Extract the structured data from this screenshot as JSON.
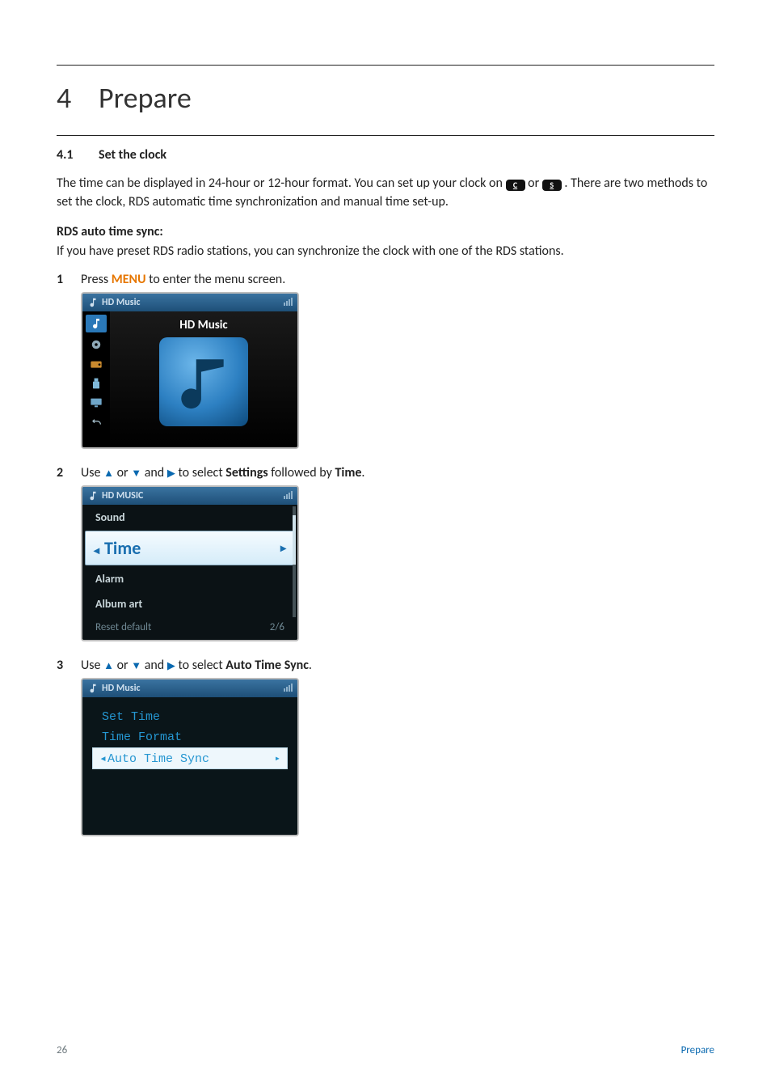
{
  "chapter": {
    "num": "4",
    "title": "Prepare"
  },
  "section": {
    "num": "4.1",
    "title": "Set the clock"
  },
  "intro_parts": {
    "a": "The time can be displayed in 24-hour or 12-hour format. You can set up your clock on ",
    "b": " or ",
    "c": ". There are two methods to set the clock, RDS automatic time synchronization and manual time set-up."
  },
  "badges": {
    "c": "C",
    "s": "S"
  },
  "rds": {
    "heading": "RDS auto time sync:",
    "text": "If you have preset RDS radio stations, you can synchronize the clock with one of the RDS stations."
  },
  "steps": {
    "s1": {
      "num": "1",
      "pre": "Press ",
      "menu": "MENU",
      "post": " to enter the menu screen."
    },
    "s2": {
      "num": "2",
      "pre": "Use ",
      "mid1": " or ",
      "mid2": " and ",
      "mid3": " to select ",
      "settings": "Settings",
      "mid4": " followed by ",
      "time": "Time",
      "end": "."
    },
    "s3": {
      "num": "3",
      "pre": "Use ",
      "mid1": " or ",
      "mid2": " and ",
      "mid3": " to select ",
      "ats": "Auto Time Sync",
      "end": "."
    }
  },
  "shot1": {
    "header": "HD Music",
    "title": "HD Music"
  },
  "shot2": {
    "header": "HD MUSIC",
    "items_top": [
      "Sound"
    ],
    "selected": "Time",
    "items_mid": [
      "Alarm",
      "Album art"
    ],
    "bottom_left": "Reset default",
    "bottom_right": "2/6"
  },
  "shot3": {
    "header": "HD Music",
    "items": [
      "Set Time",
      "Time Format"
    ],
    "selected": "Auto Time Sync"
  },
  "footer": {
    "page": "26",
    "crumb": "Prepare"
  }
}
